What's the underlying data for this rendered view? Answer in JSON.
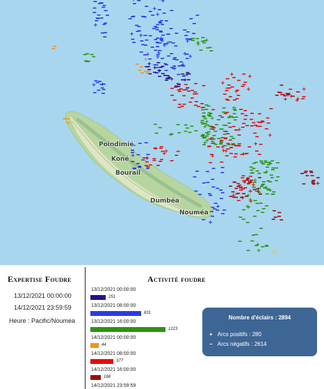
{
  "map": {
    "colors": {
      "sea": "#a9d6ef",
      "land": "#b7d59f",
      "land_light": "#dfe8c9",
      "ridge": "#8fb88a",
      "road": "#c9b488"
    },
    "places": [
      "Poindimié",
      "Koné",
      "Bourail",
      "Dumbéa",
      "Nouméa"
    ],
    "legend_colors": {
      "period_1": "#2b0f8c",
      "period_2": "#2a3ae6",
      "period_3": "#2a9412",
      "period_4": "#f29411",
      "period_5": "#e50d0d",
      "period_6": "#9b0c0c"
    },
    "symbols": {
      "positive": "+",
      "negative": "−"
    }
  },
  "left_panel": {
    "title": "Expertise Foudre",
    "start": "13/12/2021 00:00:00",
    "end": "14/12/2021 23:59:59",
    "timezone": "Heure : Pacific/Noumea"
  },
  "activity": {
    "title": "Activité foudre",
    "periods": [
      {
        "label": "13/12/2021 00:00:00",
        "value": 251,
        "color": "#2b0f8c"
      },
      {
        "label": "13/12/2021 08:00:00",
        "value": 831,
        "color": "#2a3ae6"
      },
      {
        "label": "13/12/2021 16:00:00",
        "value": 1223,
        "color": "#2a9412"
      },
      {
        "label": "14/12/2021 00:00:00",
        "value": 44,
        "color": "#f29411"
      },
      {
        "label": "14/12/2021 08:00:00",
        "value": 377,
        "color": "#e50d0d"
      },
      {
        "label": "14/12/2021 16:00:00",
        "value": 168,
        "color": "#9b0c0c"
      }
    ],
    "end_label": "14/12/2021 23:59:59"
  },
  "summary": {
    "title": "Nombre d'éclairs : 2894",
    "positive_symbol": "+",
    "positive_label": "Arcs positifs : 280",
    "negative_symbol": "−",
    "negative_label": "Arcs négatifs : 2614"
  }
}
